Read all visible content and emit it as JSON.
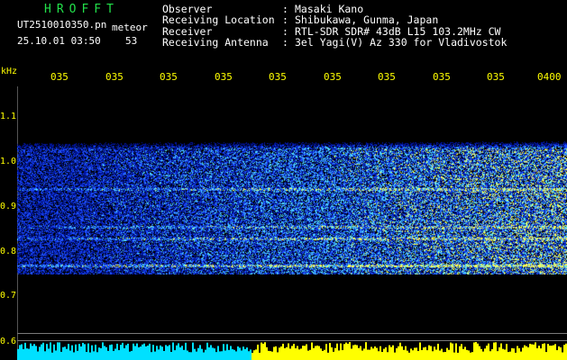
{
  "header": {
    "station": "HROFFT",
    "filename": "UT2510010350.pn",
    "meteor_label": "meteor",
    "datetime": "25.10.01 03:50",
    "count": "53"
  },
  "meta": [
    {
      "key": "Observer",
      "value": "Masaki Kano"
    },
    {
      "key": "Receiving Location",
      "value": "Shibukawa, Gunma, Japan"
    },
    {
      "key": "Receiver",
      "value": "RTL-SDR SDR# 43dB L15 103.2MHz CW"
    },
    {
      "key": "Receiving Antenna",
      "value": "3el Yagi(V) Az 330 for Vladivostok"
    }
  ],
  "chart_data": {
    "type": "heatmap",
    "ylabel": "kHz",
    "y_ticks": [
      "1.1",
      "1.0",
      "0.9",
      "0.8",
      "0.7",
      "0.6"
    ],
    "x_ticks": [
      "035",
      "035",
      "035",
      "035",
      "035",
      "035",
      "035",
      "035",
      "035",
      "0400"
    ],
    "ylim": [
      0.6,
      1.1
    ],
    "band_khz": [
      0.76,
      1.03
    ],
    "colors": {
      "background": "#000000",
      "low": "#0014a0",
      "mid": "#1e50ff",
      "high": "#50dcff",
      "peak": "#ffff50"
    }
  }
}
